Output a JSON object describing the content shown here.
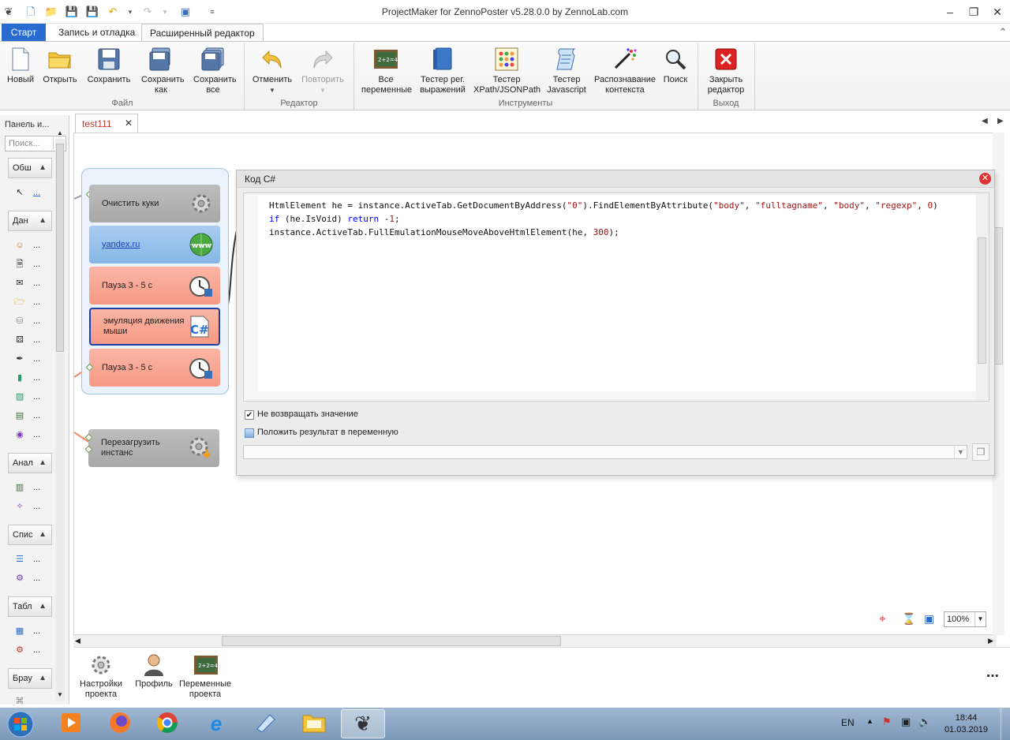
{
  "window": {
    "title": "ProjectMaker for ZennoPoster v5.28.0.0 by ZennoLab.com"
  },
  "ribbon_tabs": [
    {
      "label": "Старт"
    },
    {
      "label": "Запись и отладка"
    },
    {
      "label": "Расширенный редактор"
    }
  ],
  "ribbon": {
    "file": {
      "group": "Файл",
      "new": "Новый",
      "open": "Открыть",
      "save": "Сохранить",
      "save_as": "Сохранить как",
      "save_all": "Сохранить все"
    },
    "editor": {
      "group": "Редактор",
      "undo": "Отменить",
      "redo": "Повторить"
    },
    "tools": {
      "group": "Инструменты",
      "all_vars": "Все переменные",
      "regex": "Тестер рег. выражений",
      "xpath": "Тестер XPath/JSONPath",
      "js": "Тестер Javascript",
      "context": "Распознавание контекста",
      "search": "Поиск"
    },
    "exit": {
      "group": "Выход",
      "close": "Закрыть редактор"
    }
  },
  "left_panel": {
    "title": "Панель и...",
    "search_placeholder": "Поиск...",
    "sections": [
      {
        "label": "Обш"
      },
      {
        "label": "Дан"
      },
      {
        "label": "Анал"
      },
      {
        "label": "Спис"
      },
      {
        "label": "Табл"
      },
      {
        "label": "Брау"
      }
    ],
    "item_label": "..."
  },
  "doc_tab": {
    "label": "test111"
  },
  "blocks": {
    "clear_cookies": "Очистить куки",
    "yandex": "yandex.ru",
    "pause1": "Пауза 3 - 5 с",
    "emulation": "эмуляция движения мыши",
    "pause2": "Пауза 3 - 5 с",
    "reload": "Перезагрузить инстанс"
  },
  "code_window": {
    "title": "Код C#",
    "lines": [
      "HtmlElement he = instance.ActiveTab.GetDocumentByAddress(\"0\").FindElementByAttribute(\"body\", \"fulltagname\", \"body\", \"regexp\", 0)",
      "if (he.IsVoid) return -1;",
      "instance.ActiveTab.FullEmulationMouseMoveAboveHtmlElement(he, 300);"
    ],
    "no_return_label": "Не возвращать значение",
    "put_result_label": "Положить результат в переменную"
  },
  "zoom": {
    "value": "100%"
  },
  "bottom_bar": {
    "settings": "Настройки проекта",
    "profile": "Профиль",
    "vars": "Переменные проекта"
  },
  "taskbar": {
    "lang": "EN",
    "time": "18:44",
    "date": "01.03.2019"
  },
  "colors": {
    "accent": "#2a6bd0",
    "block_gray": "#b3b3b3",
    "block_blue": "#94bfea",
    "block_red": "#f8a793",
    "selected_border": "#1f3fa8"
  }
}
